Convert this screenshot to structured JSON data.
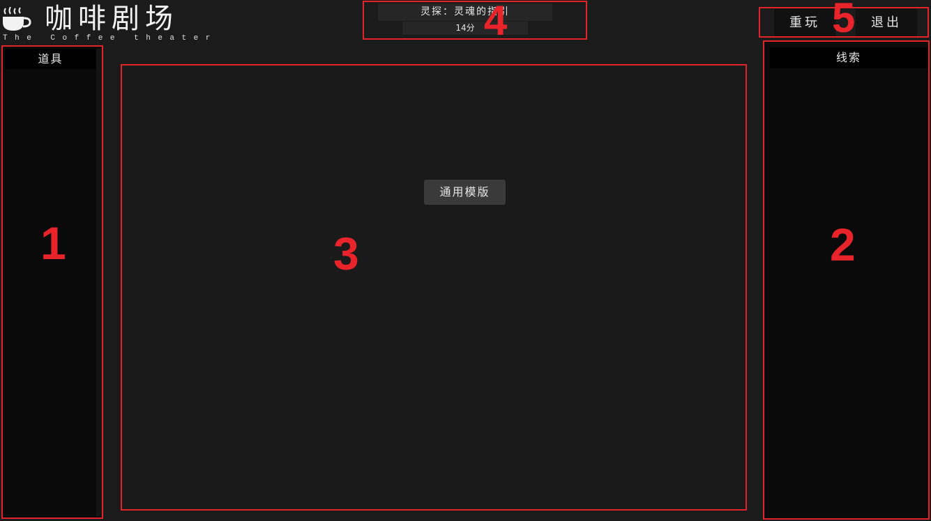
{
  "logo": {
    "icon": "coffee-cup-icon",
    "title": "咖啡剧场",
    "subtitle": "The Coffee theater"
  },
  "story": {
    "title": "灵探：灵魂的指引",
    "duration": "14分"
  },
  "controls": {
    "replay_label": "重玩",
    "exit_label": "退出"
  },
  "props_panel": {
    "header": "道具",
    "items": []
  },
  "clues_panel": {
    "header": "线索",
    "items": []
  },
  "main": {
    "template_button_label": "通用模版"
  },
  "annotations": {
    "m1": "1",
    "m2": "2",
    "m3": "3",
    "m4": "4",
    "m5": "5"
  },
  "colors": {
    "background": "#1b1b1b",
    "panel": "#0b0b0b",
    "annotation_red": "#e0242a",
    "button": "#3a3a3a",
    "text": "#e6e6e6"
  }
}
